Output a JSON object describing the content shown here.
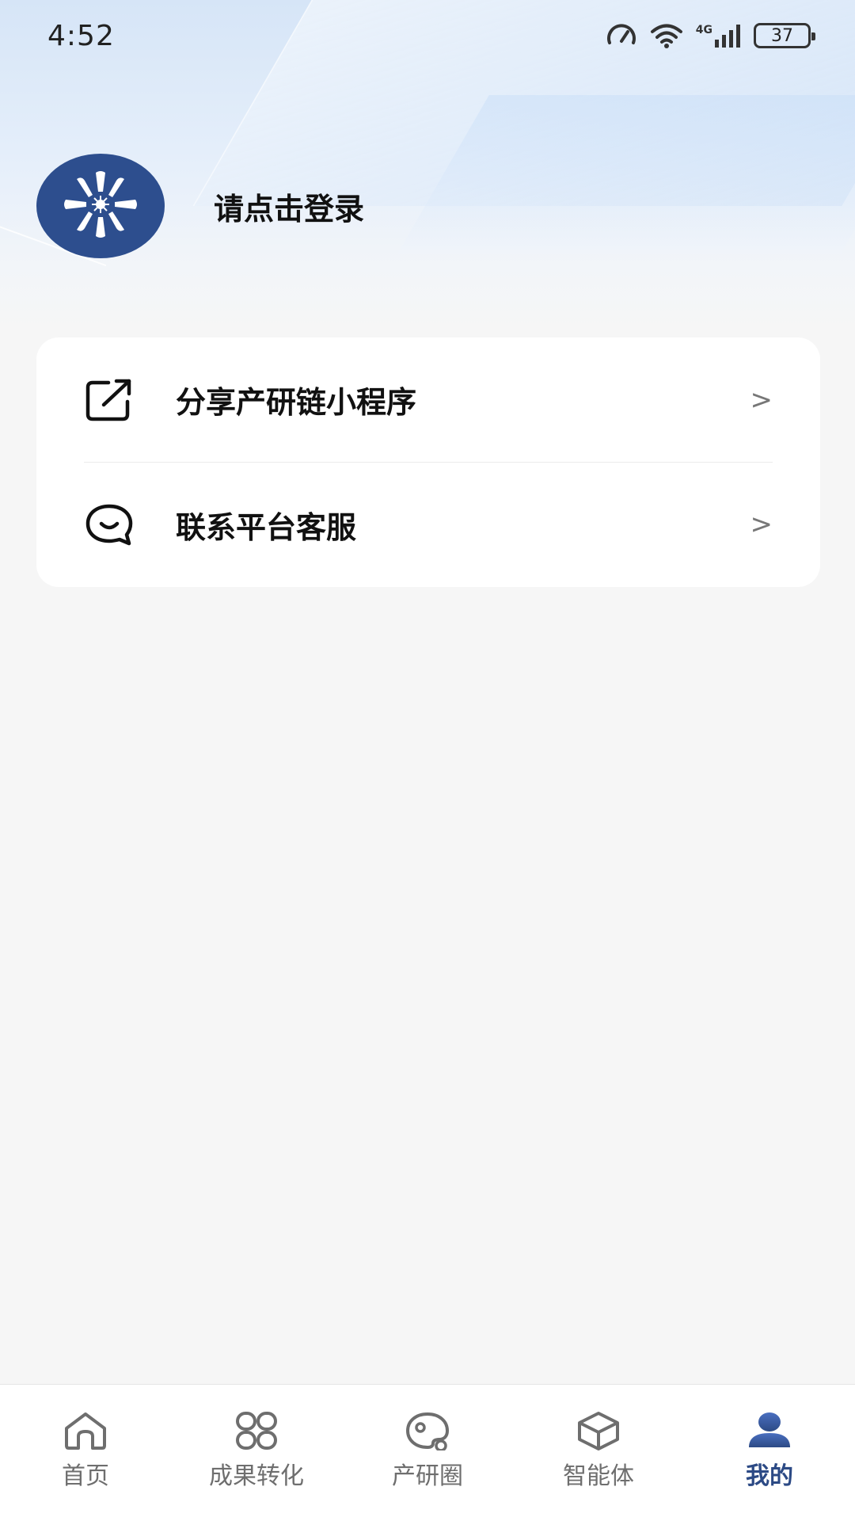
{
  "status_bar": {
    "time": "4:52",
    "network": "4G",
    "battery": "37"
  },
  "profile": {
    "login_prompt": "请点击登录",
    "avatar_icon": "snowflake-logo-icon"
  },
  "menu": {
    "items": [
      {
        "label": "分享产研链小程序",
        "icon": "share-external-icon",
        "chevron": ">"
      },
      {
        "label": "联系平台客服",
        "icon": "chat-smile-icon",
        "chevron": ">"
      }
    ]
  },
  "tabbar": {
    "items": [
      {
        "label": "首页",
        "icon": "home-icon",
        "active": false
      },
      {
        "label": "成果转化",
        "icon": "grid-clover-icon",
        "active": false
      },
      {
        "label": "产研圈",
        "icon": "palette-circle-icon",
        "active": false
      },
      {
        "label": "智能体",
        "icon": "cube-icon",
        "active": false
      },
      {
        "label": "我的",
        "icon": "person-icon",
        "active": true
      }
    ]
  },
  "colors": {
    "accent": "#2c4a85",
    "avatar_bg": "#2d4e8e",
    "inactive_tab": "#6e6e6e",
    "page_bg": "#f6f6f6"
  }
}
